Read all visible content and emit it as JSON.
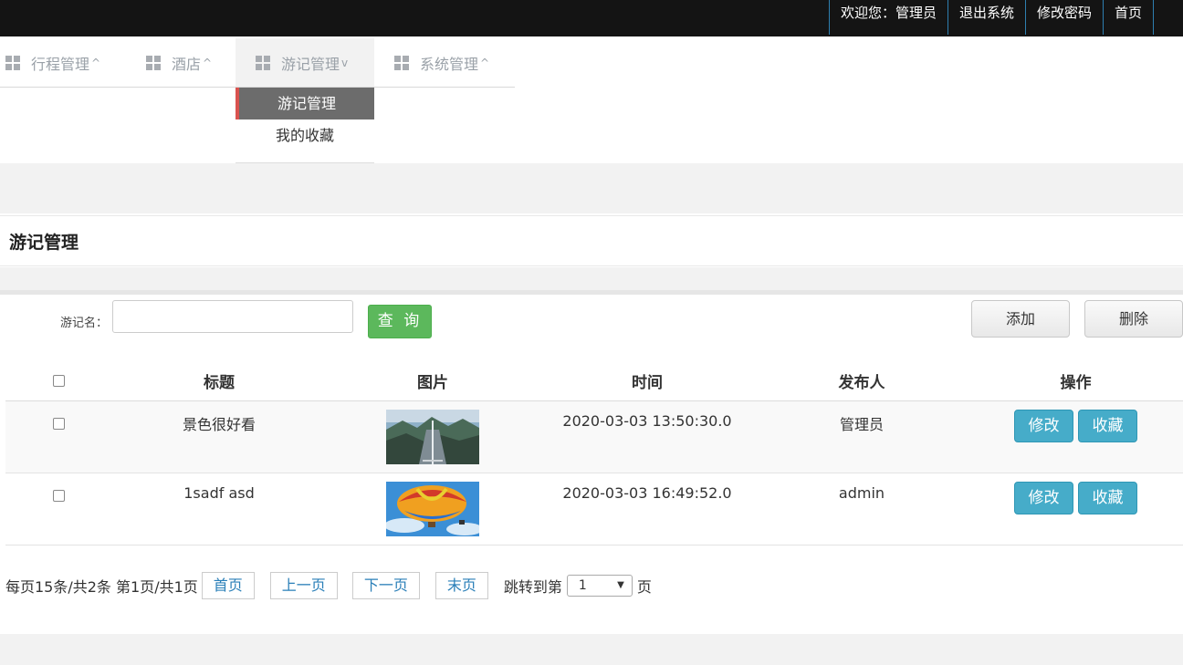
{
  "topbar": {
    "welcome": "欢迎您：管理员",
    "logout": "退出系统",
    "change_password": "修改密码",
    "home": "首页"
  },
  "nav": {
    "items": [
      {
        "label": "行程管理",
        "caret": "^"
      },
      {
        "label": "酒店",
        "caret": "^"
      },
      {
        "label": "游记管理",
        "caret": "v"
      },
      {
        "label": "系统管理",
        "caret": "^"
      }
    ],
    "dropdown": [
      "游记管理",
      "我的收藏"
    ]
  },
  "page_title": "游记管理",
  "search": {
    "label": "游记名：",
    "value": "",
    "query_button": "查 询"
  },
  "actions": {
    "add": "添加",
    "delete": "删除"
  },
  "table": {
    "headers": [
      "标题",
      "图片",
      "时间",
      "发布人",
      "操作"
    ],
    "rows": [
      {
        "title": "景色很好看",
        "image": "mountain-bridge-photo",
        "time": "2020-03-03 13:50:30.0",
        "author": "管理员",
        "edit": "修改",
        "favorite": "收藏"
      },
      {
        "title": "1sadf asd",
        "image": "hot-air-balloon-photo",
        "time": "2020-03-03 16:49:52.0",
        "author": "admin",
        "edit": "修改",
        "favorite": "收藏"
      }
    ]
  },
  "pagination": {
    "summary": "每页15条/共2条 第1页/共1页",
    "first": "首页",
    "prev": "上一页",
    "next": "下一页",
    "last": "末页",
    "jump_label": "跳转到第",
    "page_value": "1",
    "page_suffix": "页"
  },
  "colors": {
    "query_button": "#5cb85c",
    "row_action": "#46acc9",
    "topbar": "#141414"
  }
}
